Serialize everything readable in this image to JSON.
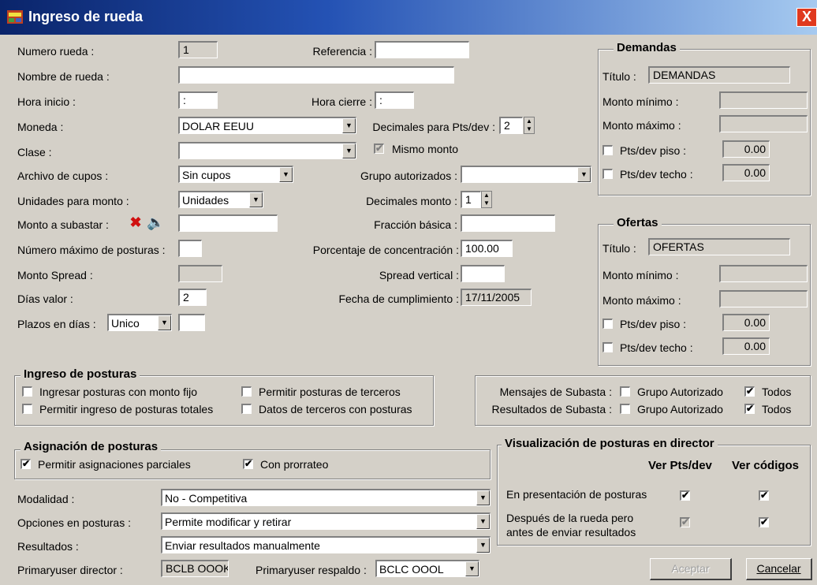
{
  "window": {
    "title": "Ingreso de rueda",
    "close": "X"
  },
  "left": {
    "numero_rueda_label": "Numero rueda :",
    "numero_rueda_value": "1",
    "referencia_label": "Referencia :",
    "referencia_value": "",
    "nombre_label": "Nombre de rueda :",
    "nombre_value": "",
    "hora_inicio_label": "Hora inicio :",
    "hora_inicio_value": ":",
    "hora_cierre_label": "Hora cierre :",
    "hora_cierre_value": ":",
    "moneda_label": "Moneda :",
    "moneda_value": "DOLAR EEUU",
    "decimales_pts_label": "Decimales para Pts/dev :",
    "decimales_pts_value": "2",
    "clase_label": "Clase :",
    "clase_value": "",
    "mismo_monto_label": "Mismo monto",
    "mismo_monto_checked": true,
    "archivo_label": "Archivo de cupos :",
    "archivo_value": "Sin cupos",
    "grupo_label": "Grupo autorizados :",
    "grupo_value": "",
    "unidades_label": "Unidades para monto :",
    "unidades_value": "Unidades",
    "decimales_monto_label": "Decimales monto :",
    "decimales_monto_value": "1",
    "monto_subastar_label": "Monto a subastar :",
    "monto_subastar_value": "",
    "fraccion_label": "Fracción básica :",
    "fraccion_value": "",
    "numero_max_label": "Número máximo de posturas :",
    "numero_max_value": "",
    "porcentaje_label": "Porcentaje de concentración :",
    "porcentaje_value": "100.00",
    "monto_spread_label": "Monto Spread :",
    "monto_spread_value": "",
    "spread_vertical_label": "Spread vertical :",
    "spread_vertical_value": "",
    "dias_valor_label": "Días valor :",
    "dias_valor_value": "2",
    "fecha_label": "Fecha de cumplimiento :",
    "fecha_value": "17/11/2005",
    "plazos_label": "Plazos en días :",
    "plazos_value": "Unico",
    "plazos_extra": ""
  },
  "demandas": {
    "title": "Demandas",
    "titulo_label": "Título :",
    "titulo_value": "DEMANDAS",
    "min_label": "Monto mínimo :",
    "min_value": "",
    "max_label": "Monto máximo :",
    "max_value": "",
    "piso_label": "Pts/dev piso :",
    "piso_value": "0.00",
    "techo_label": "Pts/dev techo :",
    "techo_value": "0.00"
  },
  "ofertas": {
    "title": "Ofertas",
    "titulo_label": "Título :",
    "titulo_value": "OFERTAS",
    "min_label": "Monto mínimo :",
    "min_value": "",
    "max_label": "Monto máximo :",
    "max_value": "",
    "piso_label": "Pts/dev piso :",
    "piso_value": "0.00",
    "techo_label": "Pts/dev techo :",
    "techo_value": "0.00"
  },
  "ingreso": {
    "title": "Ingreso de posturas",
    "monto_fijo": "Ingresar posturas con monto fijo",
    "terceros": "Permitir posturas de terceros",
    "totales": "Permitir ingreso de posturas totales",
    "datos_terceros": "Datos de terceros con posturas"
  },
  "mensajes": {
    "mensajes_label": "Mensajes de Subasta :",
    "resultados_label": "Resultados de Subasta :",
    "grupo": "Grupo Autorizado",
    "todos": "Todos"
  },
  "asignacion": {
    "title": "Asignación de posturas",
    "parciales": "Permitir asignaciones parciales",
    "prorrateo": "Con prorrateo"
  },
  "bottom": {
    "modalidad_label": "Modalidad :",
    "modalidad_value": "No - Competitiva",
    "opciones_label": "Opciones en posturas :",
    "opciones_value": "Permite modificar y retirar",
    "resultados_label": "Resultados :",
    "resultados_value": "Enviar resultados manualmente",
    "director_label": "Primaryuser director :",
    "director_value": "BCLB OOOK",
    "respaldo_label": "Primaryuser respaldo :",
    "respaldo_value": "BCLC OOOL"
  },
  "visualizacion": {
    "title": "Visualización de posturas en director",
    "col1": "Ver Pts/dev",
    "col2": "Ver códigos",
    "row1": "En presentación de posturas",
    "row2a": "Después de la rueda pero",
    "row2b": "antes de enviar resultados"
  },
  "buttons": {
    "aceptar": "Aceptar",
    "cancelar": "Cancelar"
  },
  "checkmark": "✔",
  "arrow": "▼"
}
